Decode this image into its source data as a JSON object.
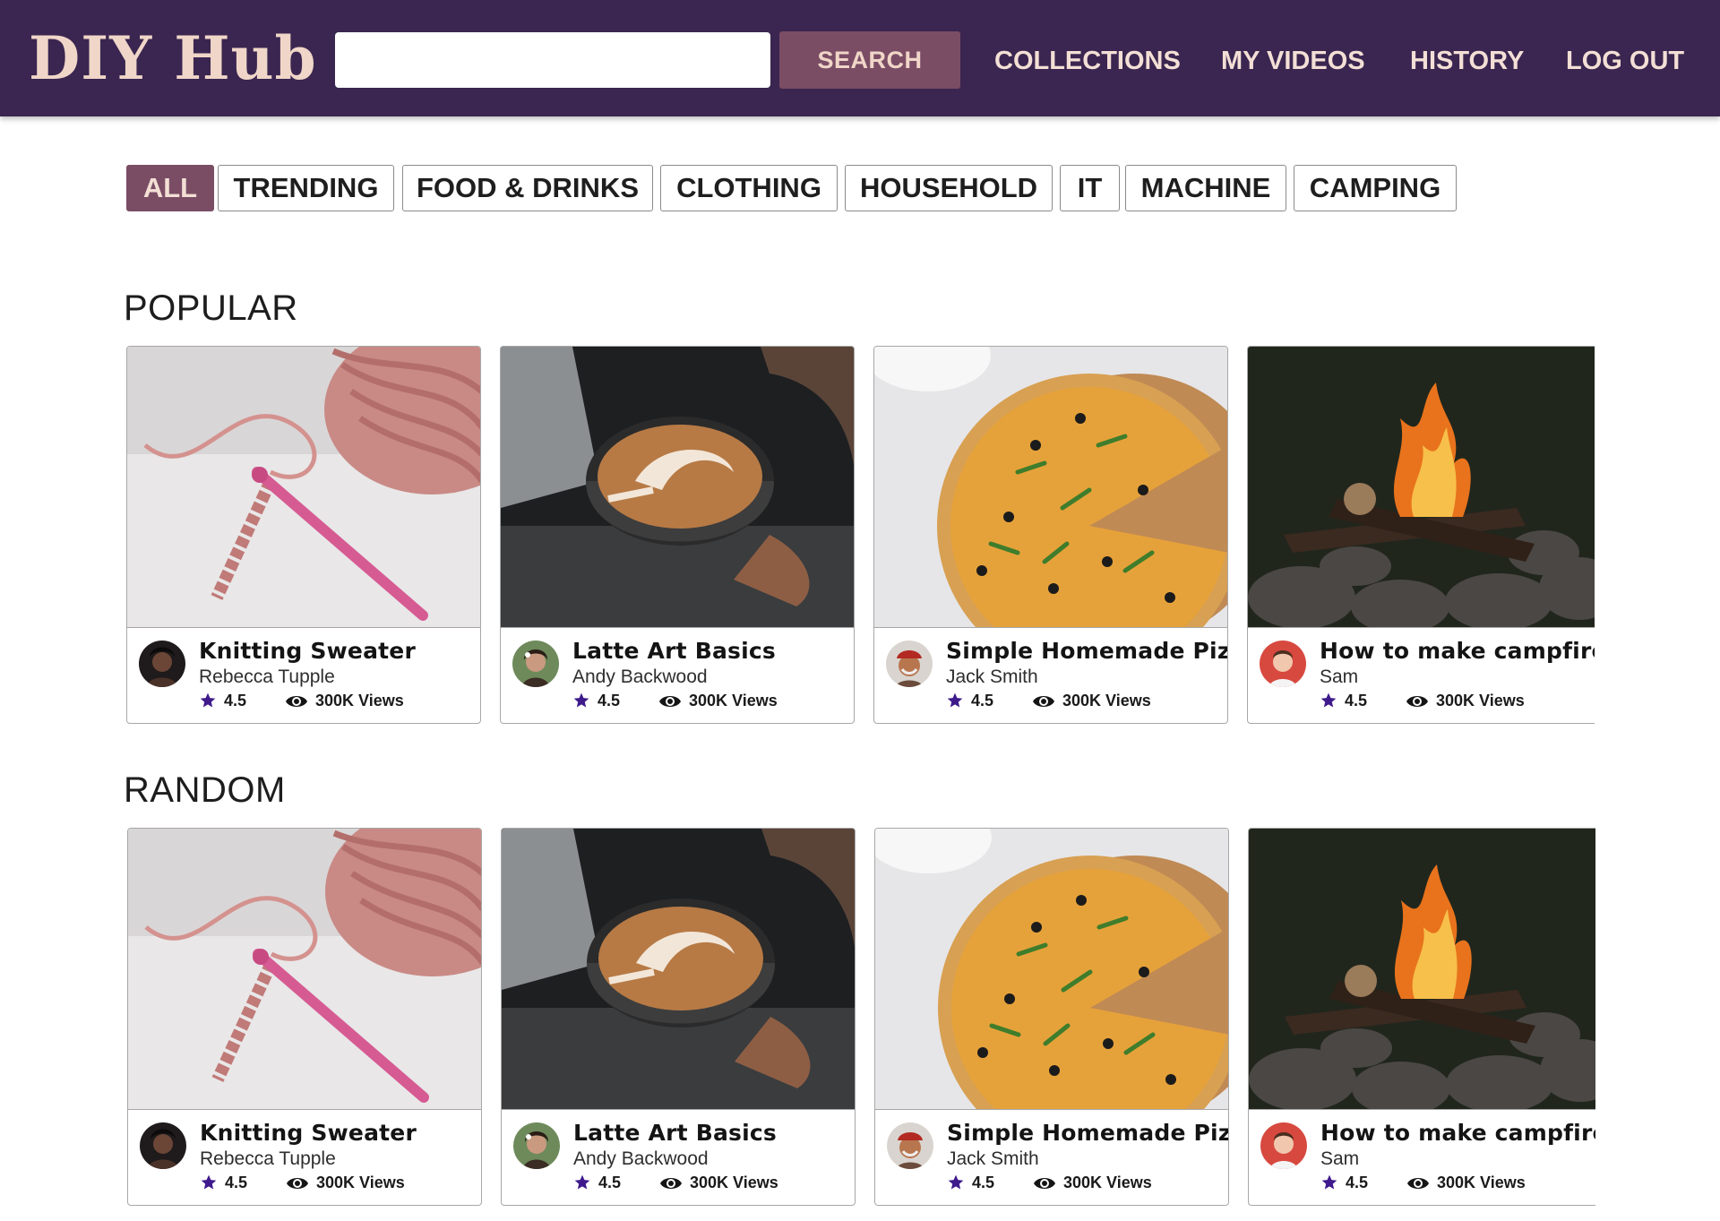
{
  "header": {
    "logo": "DIY Hub",
    "search": {
      "placeholder": "",
      "value": "",
      "button_label": "SEARCH"
    },
    "nav": [
      {
        "id": "collections",
        "label": "COLLECTIONS"
      },
      {
        "id": "my-videos",
        "label": "MY VIDEOS"
      },
      {
        "id": "history",
        "label": "HISTORY"
      },
      {
        "id": "log-out",
        "label": "LOG OUT"
      }
    ]
  },
  "categories": {
    "active": "ALL",
    "items": [
      "ALL",
      "TRENDING",
      "FOOD & DRINKS",
      "CLOTHING",
      "HOUSEHOLD",
      "IT",
      "MACHINE",
      "CAMPING"
    ]
  },
  "sections": [
    {
      "title": "POPULAR",
      "videos": [
        {
          "thumbnail": "yarn-crochet-thumbnail",
          "title": "Knitting Sweater",
          "author": "Rebecca Tupple",
          "rating": "4.5",
          "views": "300K Views"
        },
        {
          "thumbnail": "latte-art-thumbnail",
          "title": "Latte Art Basics",
          "author": "Andy Backwood",
          "rating": "4.5",
          "views": "300K Views"
        },
        {
          "thumbnail": "pizza-thumbnail",
          "title": "Simple Homemade Pizza",
          "author": "Jack Smith",
          "rating": "4.5",
          "views": "300K Views"
        },
        {
          "thumbnail": "campfire-thumbnail",
          "title": "How to make campfire",
          "author": "Sam",
          "rating": "4.5",
          "views": "300K Views"
        }
      ]
    },
    {
      "title": "RANDOM",
      "videos": [
        {
          "thumbnail": "yarn-crochet-thumbnail",
          "title": "Knitting Sweater",
          "author": "Rebecca Tupple",
          "rating": "4.5",
          "views": "300K Views"
        },
        {
          "thumbnail": "latte-art-thumbnail",
          "title": "Latte Art Basics",
          "author": "Andy Backwood",
          "rating": "4.5",
          "views": "300K Views"
        },
        {
          "thumbnail": "pizza-thumbnail",
          "title": "Simple Homemade Pizza",
          "author": "Jack Smith",
          "rating": "4.5",
          "views": "300K Views"
        },
        {
          "thumbnail": "campfire-thumbnail",
          "title": "How to make campfire",
          "author": "Sam",
          "rating": "4.5",
          "views": "300K Views"
        }
      ]
    }
  ],
  "colors": {
    "header_bg": "#3a2650",
    "accent": "#7a4d65",
    "logo": "#f0d6c8",
    "star": "#3f1a8c"
  },
  "icons": {
    "rating": "star-icon",
    "views": "eye-icon"
  }
}
